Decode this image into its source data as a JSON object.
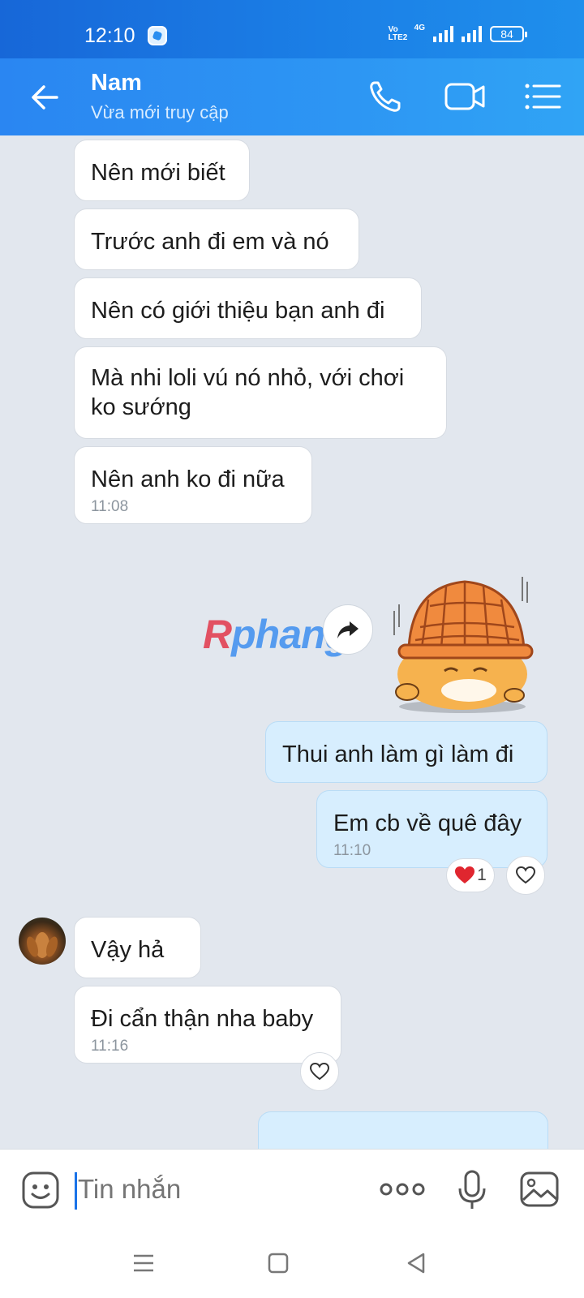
{
  "status_bar": {
    "time": "12:10",
    "volte_line1": "Vo",
    "volte_line2": "LTE2",
    "network": "4G",
    "battery": "84"
  },
  "header": {
    "name": "Nam",
    "status": "Vừa mới truy cập",
    "icons": [
      "back-arrow-icon",
      "phone-icon",
      "video-camera-icon",
      "list-menu-icon"
    ]
  },
  "messages": [
    {
      "text": "Nên mới biết",
      "from": "them"
    },
    {
      "text": "Trước anh đi em và nó",
      "from": "them"
    },
    {
      "text": "Nên có giới thiệu bạn anh đi",
      "from": "them"
    },
    {
      "text": "Mà nhi loli vú nó nhỏ, với chơi ko sướng",
      "from": "them"
    },
    {
      "text": "Nên anh ko đi nữa",
      "time": "11:08",
      "from": "them"
    },
    {
      "text": "Thui anh làm gì làm đi",
      "from": "me"
    },
    {
      "text": "Em cb về quê đây",
      "time": "11:10",
      "from": "me",
      "reaction_count": "1"
    },
    {
      "text": "Vậy hả",
      "from": "them"
    },
    {
      "text": "Đi cẩn thận nha baby",
      "time": "11:16",
      "from": "them"
    }
  ],
  "watermark": {
    "first": "R",
    "rest": "phang"
  },
  "input": {
    "placeholder": "Tin nhắn"
  },
  "colors": {
    "header": "#2a86f2",
    "my_bubble": "#d7eefe",
    "their_bubble": "#ffffff",
    "chat_background": "#e2e7ee",
    "reaction_heart": "#e0262f"
  }
}
